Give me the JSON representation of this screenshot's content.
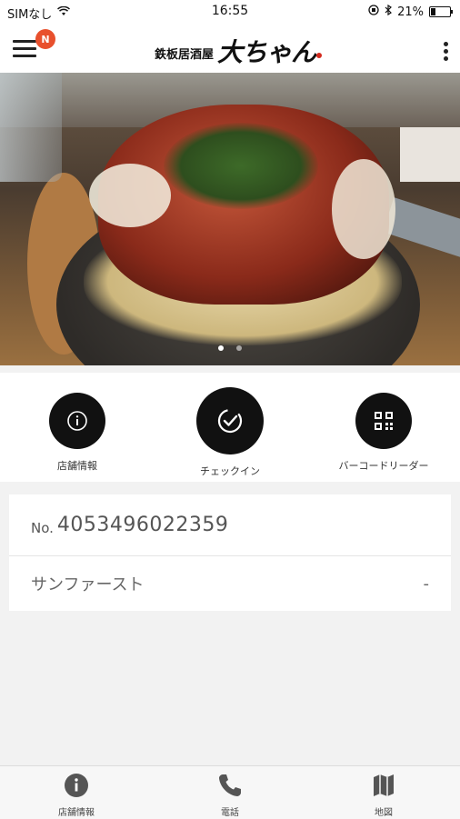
{
  "status_bar": {
    "carrier": "SIMなし",
    "time": "16:55",
    "battery": "21%",
    "battery_level": 0.21
  },
  "header": {
    "notification_badge": "N",
    "logo_small": "鉄板居酒屋",
    "logo_big": "大ちゃん"
  },
  "carousel": {
    "slide_count": 2,
    "active_slide": 1
  },
  "actions": [
    {
      "label": "店舗情報",
      "icon": "info-icon"
    },
    {
      "label": "チェックイン",
      "icon": "check-icon"
    },
    {
      "label": "バーコードリーダー",
      "icon": "qr-code-icon"
    }
  ],
  "member": {
    "number_prefix": "No.",
    "number": "4053496022359",
    "rank_name": "サンファースト",
    "rank_value": "-"
  },
  "tabs": [
    {
      "label": "店舗情報",
      "icon": "info-icon"
    },
    {
      "label": "電話",
      "icon": "phone-icon"
    },
    {
      "label": "地図",
      "icon": "map-icon"
    }
  ]
}
